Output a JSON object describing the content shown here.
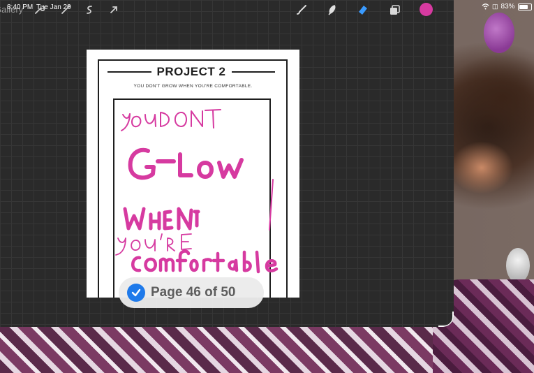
{
  "status_bar": {
    "time": "8:40 PM",
    "date": "Tue Jan 20",
    "battery": "83%"
  },
  "toolbar": {
    "gallery_label": "Gallery",
    "left_tools": [
      "wrench-icon",
      "magic-wand-icon",
      "selection-icon",
      "transform-arrow-icon"
    ],
    "right_tools": [
      "brush-icon",
      "smudge-icon",
      "eraser-icon",
      "layers-icon"
    ],
    "current_color": "#d63aa0"
  },
  "document": {
    "title": "PROJECT 2",
    "subtitle": "YOU DON'T GROW WHEN YOU'RE COMFORTABLE."
  },
  "handwriting": {
    "ink_color": "#d63aa0",
    "lines": [
      "YOU DONT",
      "GROW",
      "WHEN",
      "YOU'RE",
      "comfortable"
    ]
  },
  "toast": {
    "text": "Page 46 of 50"
  }
}
